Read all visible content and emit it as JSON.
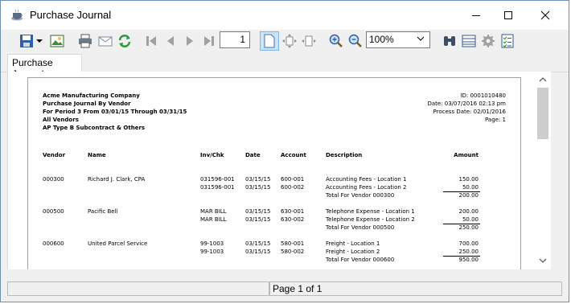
{
  "window": {
    "title": "Purchase Journal",
    "icons": {
      "app": "coffee-cup-icon",
      "minimize": "minimize-icon",
      "maximize": "maximize-icon",
      "close": "close-icon"
    }
  },
  "toolbar": {
    "current_page": "1",
    "zoom": "100%",
    "icons": [
      "save-icon",
      "dropdown-arrow-icon",
      "export-image-icon",
      "print-icon",
      "email-icon",
      "refresh-icon",
      "first-page-icon",
      "previous-page-icon",
      "next-page-icon",
      "last-page-icon",
      "single-page-view-icon",
      "fit-page-icon",
      "page-width-icon",
      "zoom-in-icon",
      "zoom-out-icon",
      "search-binoculars-icon",
      "page-setup-icon",
      "settings-gear-icon",
      "parameters-checklist-icon"
    ]
  },
  "tab": {
    "label": "Purchase Journal"
  },
  "report": {
    "header_left": [
      "Acme Manufacturing Company",
      "Purchase Journal By Vendor",
      "For Period 3 From 03/01/15 Through 03/31/15",
      "All Vendors",
      "AP Type B  Subcontract & Others"
    ],
    "header_right": [
      "ID: 0001010480",
      "Date: 03/07/2016 02:13 pm",
      "Process Date: 02/01/2016",
      "Page: 1"
    ],
    "columns": {
      "vendor": "Vendor",
      "name": "Name",
      "invchk": "Inv/Chk",
      "date": "Date",
      "account": "Account",
      "description": "Description",
      "amount": "Amount"
    },
    "groups": [
      {
        "vendor": "000300",
        "name": "Richard J. Clark, CPA",
        "rows": [
          {
            "inv": "031596-001",
            "date": "03/15/15",
            "account": "600-001",
            "description": "Accounting Fees - Location 1",
            "amount": "150.00"
          },
          {
            "inv": "031596-001",
            "date": "03/15/15",
            "account": "600-002",
            "description": "Accounting Fees - Location 2",
            "amount": "50.00"
          }
        ],
        "total_label": "Total For Vendor 000300",
        "total": "200.00"
      },
      {
        "vendor": "000500",
        "name": "Pacific Bell",
        "rows": [
          {
            "inv": "MAR BILL",
            "date": "03/15/15",
            "account": "630-001",
            "description": "Telephone Expense - Location 1",
            "amount": "200.00"
          },
          {
            "inv": "MAR BILL",
            "date": "03/15/15",
            "account": "630-002",
            "description": "Telephone Expense - Location 2",
            "amount": "50.00"
          }
        ],
        "total_label": "Total For Vendor 000500",
        "total": "250.00"
      },
      {
        "vendor": "000600",
        "name": "United Parcel Service",
        "rows": [
          {
            "inv": "99-1003",
            "date": "03/15/15",
            "account": "580-001",
            "description": "Freight - Location 1",
            "amount": "700.00"
          },
          {
            "inv": "99-1003",
            "date": "03/15/15",
            "account": "580-002",
            "description": "Freight - Location 2",
            "amount": "250.00"
          }
        ],
        "total_label": "Total For Vendor 000600",
        "total": "950.00"
      }
    ]
  },
  "scrollbar": {
    "up_icon": "scroll-up-icon",
    "down_icon": "scroll-down-icon"
  },
  "status": {
    "page_text": "Page 1 of 1"
  }
}
